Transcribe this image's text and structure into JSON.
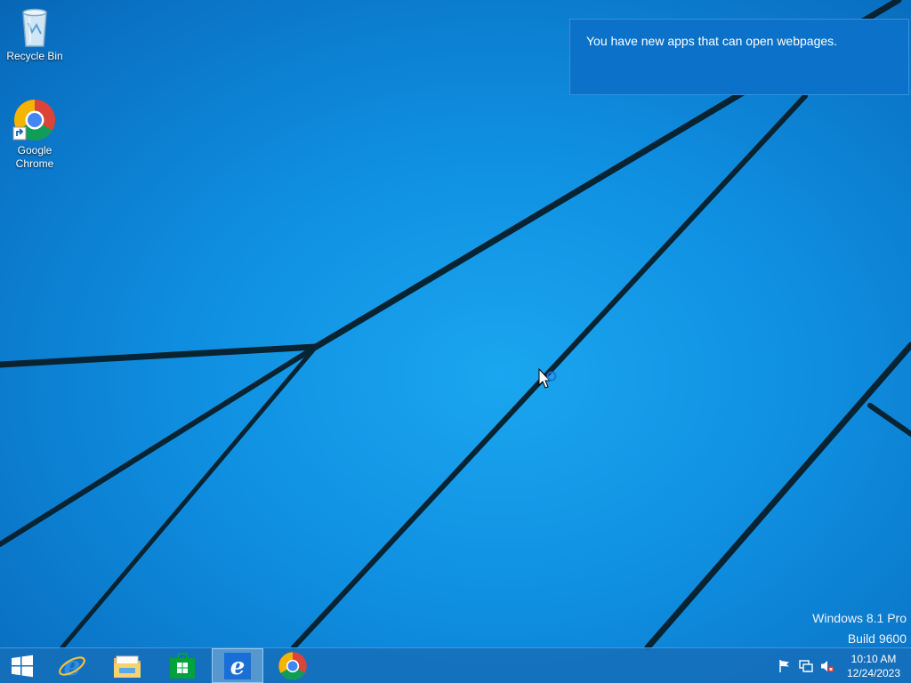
{
  "desktop": {
    "icons": [
      {
        "label": "Recycle Bin",
        "icon": "recycle-bin-icon"
      },
      {
        "label": "Google\nChrome",
        "icon": "chrome-icon"
      }
    ]
  },
  "notification": {
    "message": "You have new apps that can open webpages."
  },
  "watermark": {
    "edition": "Windows 8.1 Pro",
    "build": "Build 9600"
  },
  "taskbar": {
    "start": {
      "icon": "windows-logo-icon"
    },
    "pinned": [
      {
        "icon": "internet-explorer-icon",
        "active": false
      },
      {
        "icon": "file-explorer-icon",
        "active": false
      },
      {
        "icon": "windows-store-icon",
        "active": false
      },
      {
        "icon": "internet-explorer-icon",
        "active": true
      },
      {
        "icon": "chrome-icon",
        "active": false
      }
    ],
    "tray": {
      "icons": [
        "action-center-flag-icon",
        "network-icon",
        "volume-muted-icon"
      ],
      "time": "10:10 AM",
      "date": "12/24/2023"
    }
  },
  "colors": {
    "accent": "#0c72c9",
    "taskbar": "#166eb9",
    "wallpaper": "#1aa6f0"
  }
}
